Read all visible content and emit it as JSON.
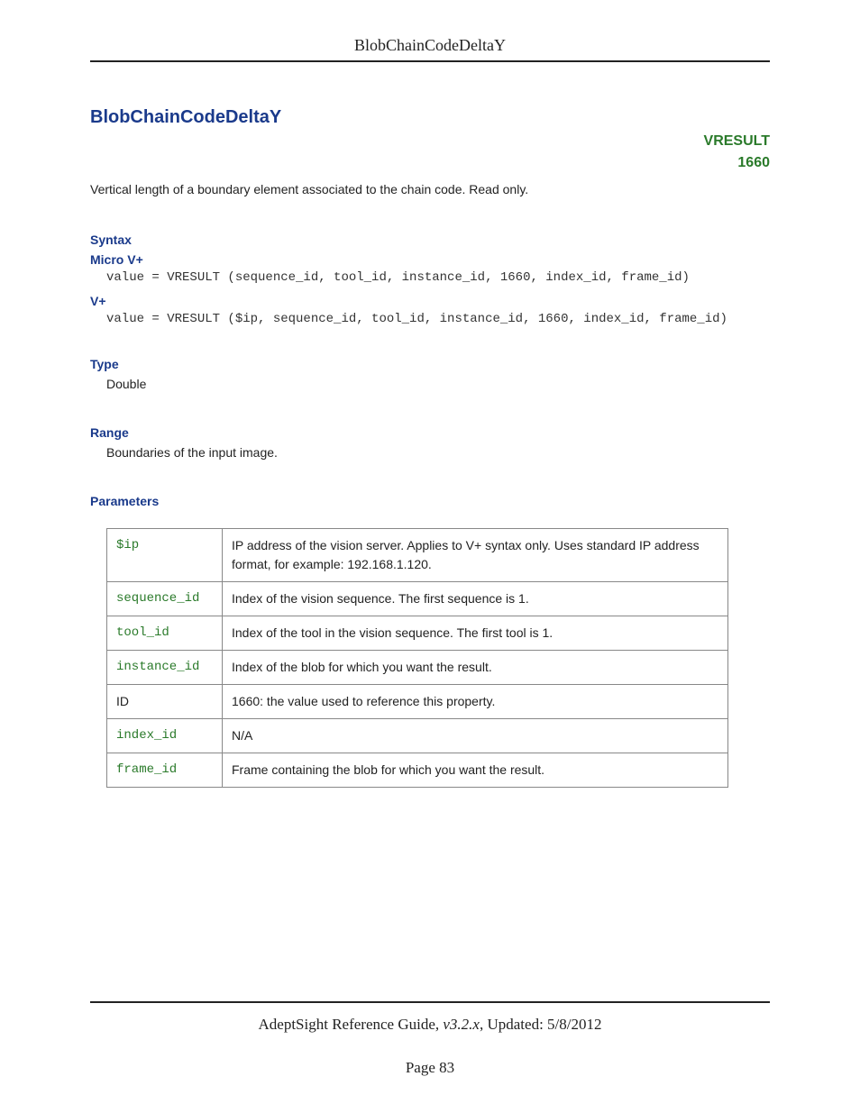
{
  "header": {
    "title": "BlobChainCodeDeltaY"
  },
  "title": "BlobChainCodeDeltaY",
  "badge": {
    "line1": "VRESULT",
    "line2": "1660"
  },
  "description": "Vertical length of a boundary element associated to the chain code. Read only.",
  "syntax": {
    "heading": "Syntax",
    "micro": {
      "label": "Micro V+",
      "code": "value = VRESULT (sequence_id, tool_id, instance_id, 1660, index_id, frame_id)"
    },
    "vplus": {
      "label": "V+",
      "code": "value = VRESULT ($ip, sequence_id, tool_id, instance_id, 1660, index_id, frame_id)"
    }
  },
  "type": {
    "heading": "Type",
    "value": "Double"
  },
  "range": {
    "heading": "Range",
    "value": "Boundaries of the input image."
  },
  "parameters": {
    "heading": "Parameters",
    "rows": [
      {
        "name": "$ip",
        "is_code": true,
        "desc": "IP address of the vision server. Applies to V+ syntax only. Uses standard IP address format, for example: 192.168.1.120."
      },
      {
        "name": "sequence_id",
        "is_code": true,
        "desc": "Index of the vision sequence. The first sequence is 1."
      },
      {
        "name": "tool_id",
        "is_code": true,
        "desc": "Index of the tool in the vision sequence. The first tool is 1."
      },
      {
        "name": "instance_id",
        "is_code": true,
        "desc": "Index of the blob for which you want the result."
      },
      {
        "name": "ID",
        "is_code": false,
        "desc": "1660: the value used to reference this property."
      },
      {
        "name": "index_id",
        "is_code": true,
        "desc": "N/A"
      },
      {
        "name": "frame_id",
        "is_code": true,
        "desc": "Frame containing the blob for which you want the result."
      }
    ]
  },
  "footer": {
    "book": "AdeptSight Reference Guide",
    "version": ", v3.2.x",
    "updated": ", Updated: 5/8/2012",
    "page": "Page 83"
  }
}
